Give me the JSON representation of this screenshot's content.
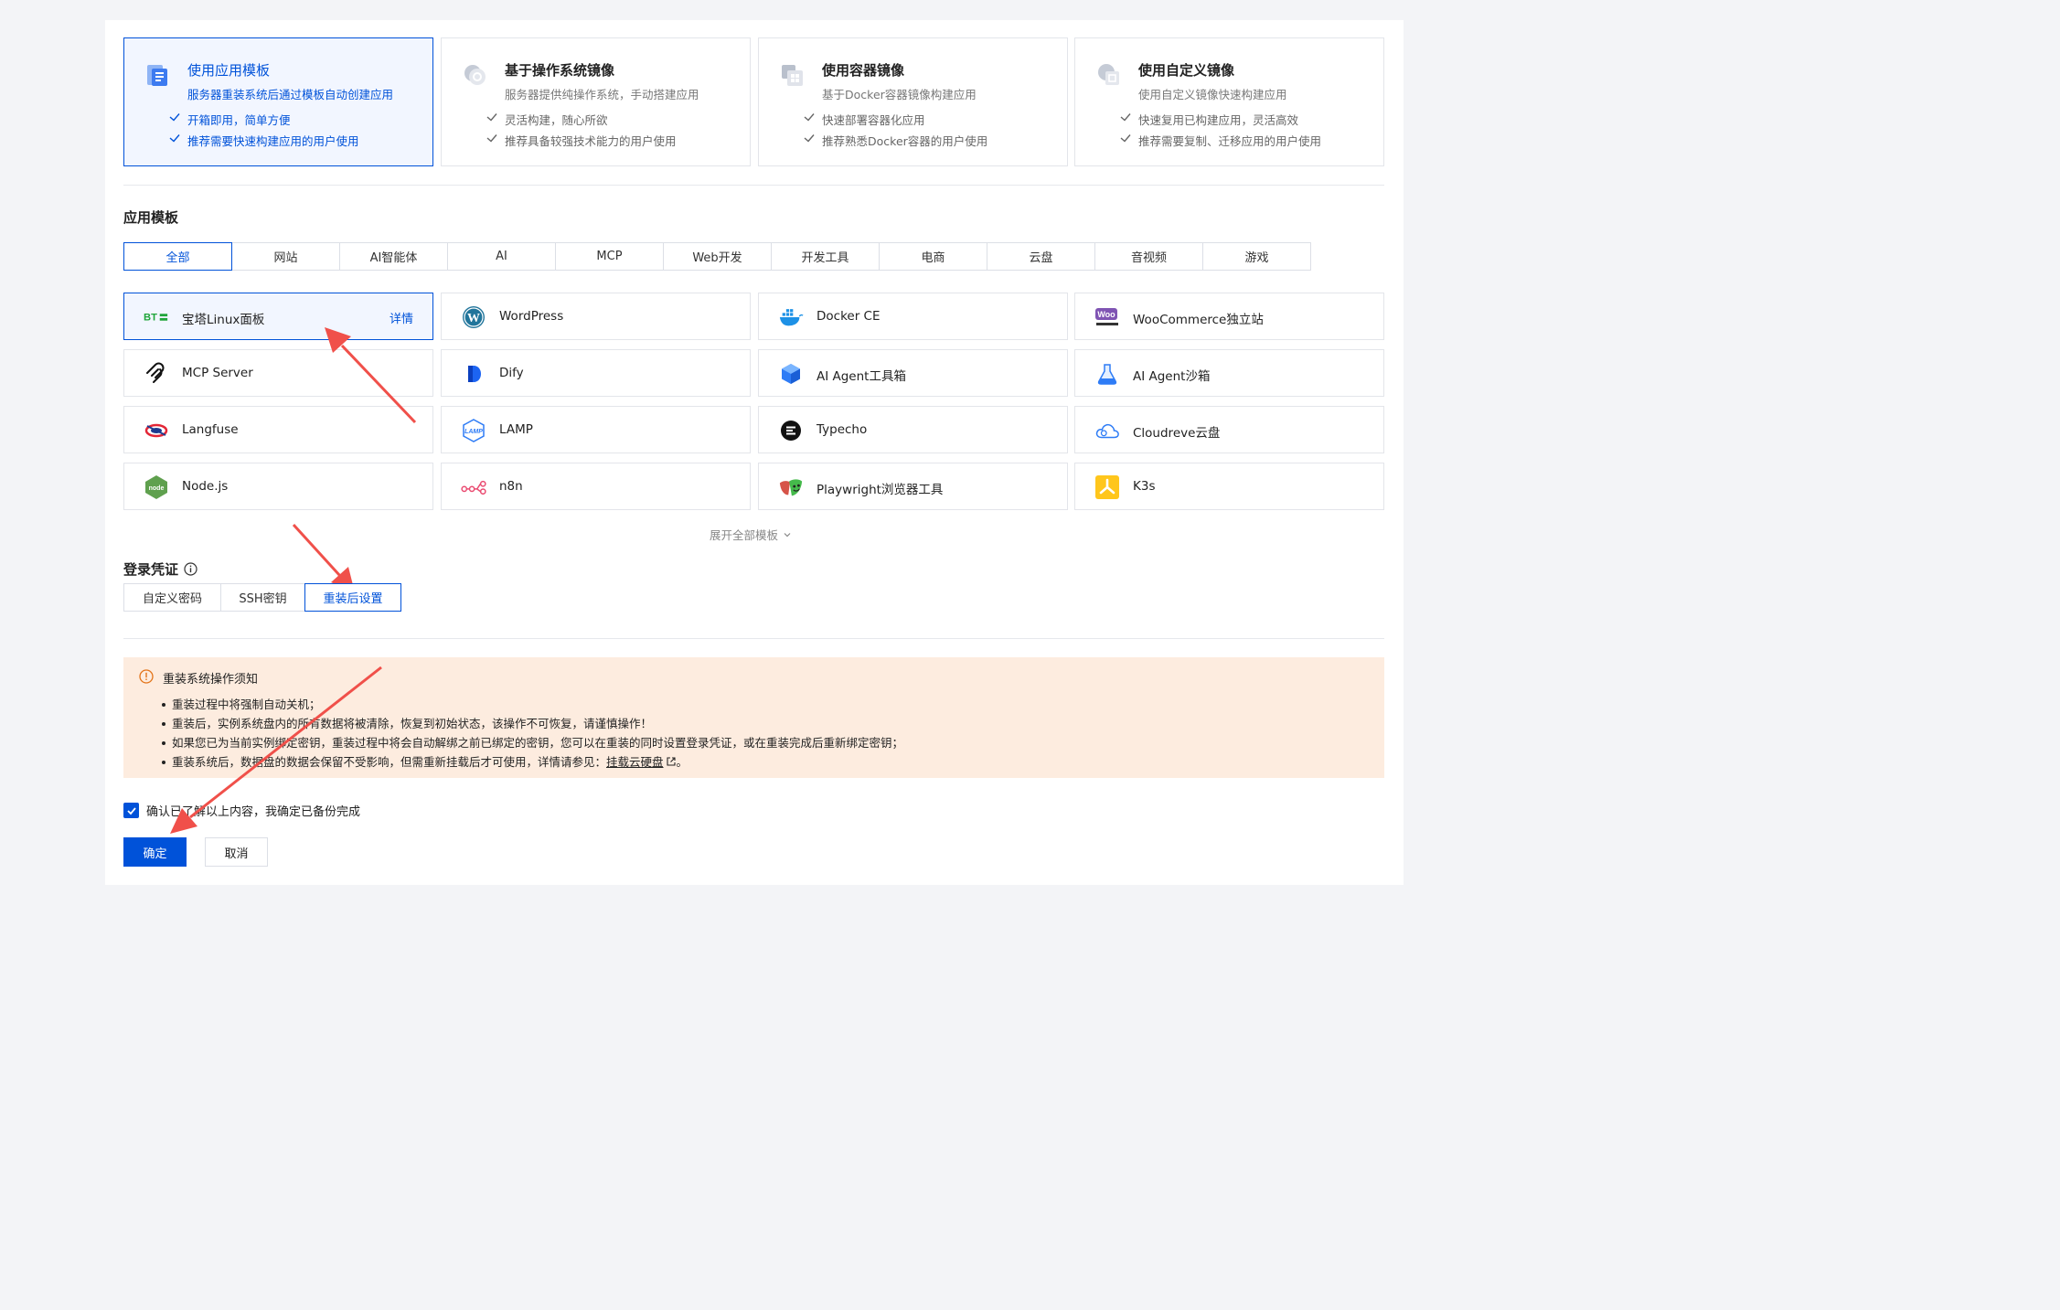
{
  "image_types": [
    {
      "title": "使用应用模板",
      "subtitle": "服务器重装系统后通过模板自动创建应用",
      "bullets": [
        "开箱即用，简单方便",
        "推荐需要快速构建应用的用户使用"
      ],
      "icon": "app-template-icon"
    },
    {
      "title": "基于操作系统镜像",
      "subtitle": "服务器提供纯操作系统，手动搭建应用",
      "bullets": [
        "灵活构建，随心所欲",
        "推荐具备较强技术能力的用户使用"
      ],
      "icon": "os-image-icon"
    },
    {
      "title": "使用容器镜像",
      "subtitle": "基于Docker容器镜像构建应用",
      "bullets": [
        "快速部署容器化应用",
        "推荐熟悉Docker容器的用户使用"
      ],
      "icon": "container-image-icon"
    },
    {
      "title": "使用自定义镜像",
      "subtitle": "使用自定义镜像快速构建应用",
      "bullets": [
        "快速复用已构建应用，灵活高效",
        "推荐需要复制、迁移应用的用户使用"
      ],
      "icon": "custom-image-icon"
    }
  ],
  "templates_section": {
    "title": "应用模板",
    "tabs": [
      "全部",
      "网站",
      "AI智能体",
      "AI",
      "MCP",
      "Web开发",
      "开发工具",
      "电商",
      "云盘",
      "音视频",
      "游戏"
    ],
    "active_tab": "全部",
    "detail_label": "详情",
    "expand_label": "展开全部模板",
    "apps": [
      {
        "name": "宝塔Linux面板",
        "icon": "bt-panel-icon"
      },
      {
        "name": "WordPress",
        "icon": "wordpress-icon"
      },
      {
        "name": "Docker CE",
        "icon": "docker-icon"
      },
      {
        "name": "WooCommerce独立站",
        "icon": "woocommerce-icon"
      },
      {
        "name": "MCP Server",
        "icon": "mcp-icon"
      },
      {
        "name": "Dify",
        "icon": "dify-icon"
      },
      {
        "name": "AI Agent工具箱",
        "icon": "ai-agent-toolbox-icon"
      },
      {
        "name": "AI Agent沙箱",
        "icon": "ai-agent-sandbox-icon"
      },
      {
        "name": "Langfuse",
        "icon": "langfuse-icon"
      },
      {
        "name": "LAMP",
        "icon": "lamp-icon"
      },
      {
        "name": "Typecho",
        "icon": "typecho-icon"
      },
      {
        "name": "Cloudreve云盘",
        "icon": "cloudreve-icon"
      },
      {
        "name": "Node.js",
        "icon": "nodejs-icon"
      },
      {
        "name": "n8n",
        "icon": "n8n-icon"
      },
      {
        "name": "Playwright浏览器工具",
        "icon": "playwright-icon"
      },
      {
        "name": "K3s",
        "icon": "k3s-icon"
      }
    ]
  },
  "credentials": {
    "title": "登录凭证",
    "tabs": [
      "自定义密码",
      "SSH密钥",
      "重装后设置"
    ],
    "active_tab": "重装后设置"
  },
  "notice": {
    "title": "重装系统操作须知",
    "items": [
      "重装过程中将强制自动关机；",
      "重装后，实例系统盘内的所有数据将被清除，恢复到初始状态，该操作不可恢复，请谨慎操作！",
      "如果您已为当前实例绑定密钥，重装过程中将会自动解绑之前已绑定的密钥，您可以在重装的同时设置登录凭证，或在重装完成后重新绑定密钥；"
    ],
    "last_item_prefix": "重装系统后，数据盘的数据会保留不受影响，但需重新挂载后才可使用，详情请参见：",
    "last_item_link": "挂载云硬盘",
    "last_item_suffix": "。"
  },
  "confirm": {
    "label": "确认已了解以上内容，我确定已备份完成",
    "checked": true
  },
  "buttons": {
    "ok": "确定",
    "cancel": "取消"
  },
  "colors": {
    "accent": "#0052d9",
    "notice_bg": "#fdecdf",
    "annotation_arrow": "#f0504a"
  }
}
